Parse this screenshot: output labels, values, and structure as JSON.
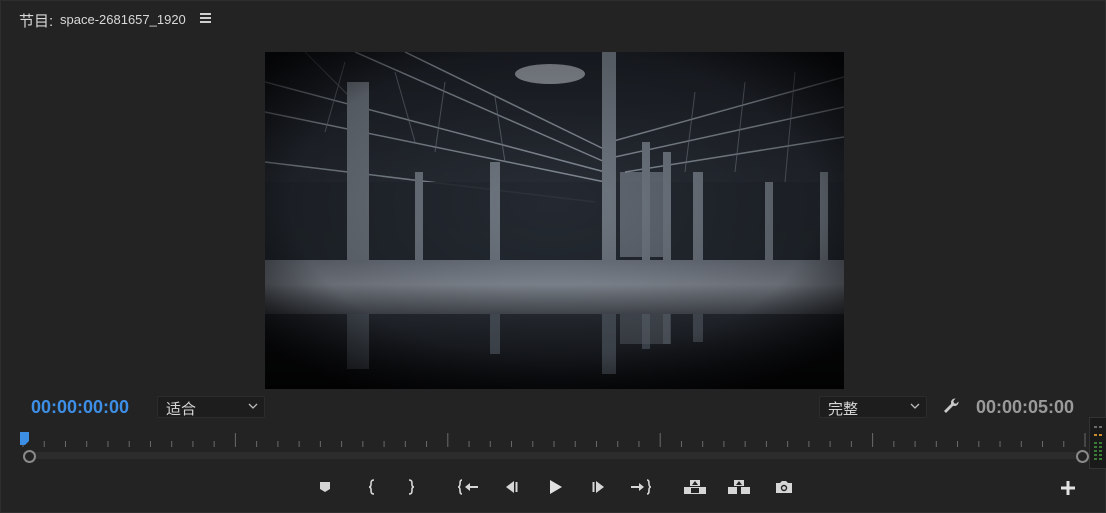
{
  "panel": {
    "title_prefix": "节目:",
    "sequence_name": "space-2681657_1920"
  },
  "timecode": {
    "current": "00:00:00:00",
    "duration": "00:00:05:00"
  },
  "zoom_dropdown": {
    "selected": "适合"
  },
  "quality_dropdown": {
    "selected": "完整"
  },
  "colors": {
    "accent": "#3d8fe6",
    "background": "#232323",
    "text": "#cfcfcf"
  },
  "transport_buttons": [
    {
      "name": "add-marker",
      "icon": "marker-icon"
    },
    {
      "name": "mark-in",
      "icon": "mark-in-icon"
    },
    {
      "name": "mark-out",
      "icon": "mark-out-icon"
    },
    {
      "name": "go-to-in",
      "icon": "go-to-in-icon"
    },
    {
      "name": "step-back",
      "icon": "step-back-icon"
    },
    {
      "name": "play",
      "icon": "play-icon"
    },
    {
      "name": "step-forward",
      "icon": "step-forward-icon"
    },
    {
      "name": "go-to-out",
      "icon": "go-to-out-icon"
    },
    {
      "name": "lift",
      "icon": "lift-icon"
    },
    {
      "name": "extract",
      "icon": "extract-icon"
    },
    {
      "name": "export-frame",
      "icon": "camera-icon"
    }
  ]
}
